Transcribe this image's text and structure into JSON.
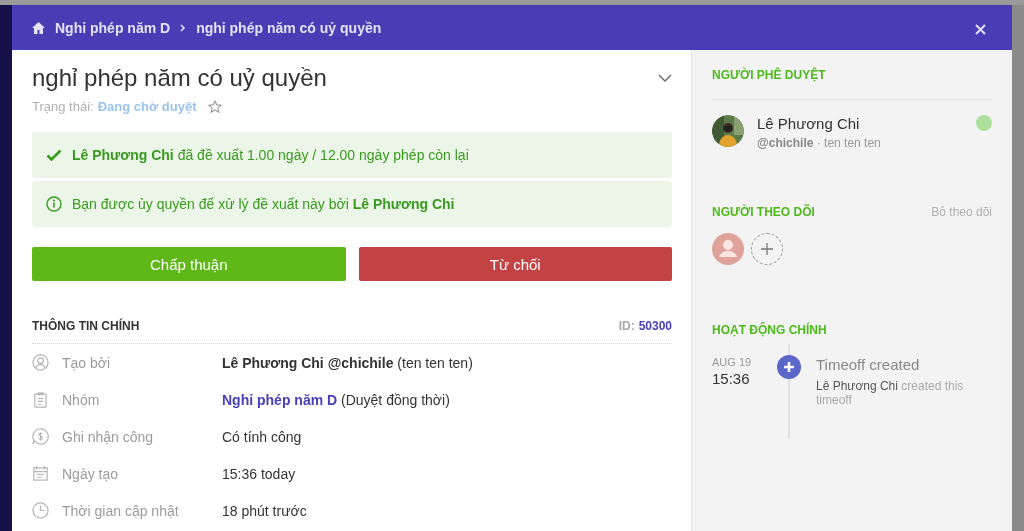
{
  "breadcrumb": [
    {
      "label": "Nghỉ phép năm D"
    },
    {
      "label": "nghỉ phép năm có uỷ quyền"
    }
  ],
  "title": "nghỉ phép năm có uỷ quyền",
  "status": {
    "label": "Trạng thái:",
    "value": "Đang chờ duyệt",
    "starred": false
  },
  "alerts": [
    {
      "kind": "success",
      "text": "**Lê Phương Chi** đã đề xuất 1.00 ngày / 12.00 ngày phép còn lại"
    },
    {
      "kind": "info",
      "text": "Bạn được ủy quyền để xử lý đề xuất này bởi **Lê Phương Chi**"
    }
  ],
  "actions": [
    {
      "kind": "approve",
      "label": "Chấp thuận"
    },
    {
      "kind": "reject",
      "label": "Từ chối"
    }
  ],
  "main_info": {
    "heading": "THÔNG TIN CHÍNH",
    "id_label": "ID:",
    "id_value": "50300",
    "rows": [
      {
        "kind": "user",
        "label": "Tạo bởi",
        "value": "**Lê Phương Chi @chichile** (ten ten ten)"
      },
      {
        "kind": "group",
        "label": "Nhóm",
        "link": "Nghỉ phép năm D",
        "value": "(Duyệt đồng thời)"
      },
      {
        "kind": "pay",
        "label": "Ghi nhận công",
        "value": "Có tính công"
      },
      {
        "kind": "date",
        "label": "Ngày tạo",
        "value": "15:36 today"
      },
      {
        "kind": "time",
        "label": "Thời gian cập nhật",
        "value": "18 phút trước"
      }
    ]
  },
  "approvers": {
    "heading": "NGƯỜI PHÊ DUYỆT",
    "people": [
      {
        "name": "Lê Phương Chi",
        "detail": "**@chichile** · ten ten ten",
        "color": "#addf9d"
      }
    ]
  },
  "followers": {
    "heading": "NGƯỜI THEO DÕI",
    "action": "Bỏ theo dõi"
  },
  "activity": {
    "heading": "HOẠT ĐỘNG CHÍNH",
    "events": [
      {
        "date": "AUG 19",
        "time": "15:36",
        "title": "Timeoff created",
        "actor": "Lê Phương Chi",
        "text": "created this timeoff"
      }
    ]
  }
}
